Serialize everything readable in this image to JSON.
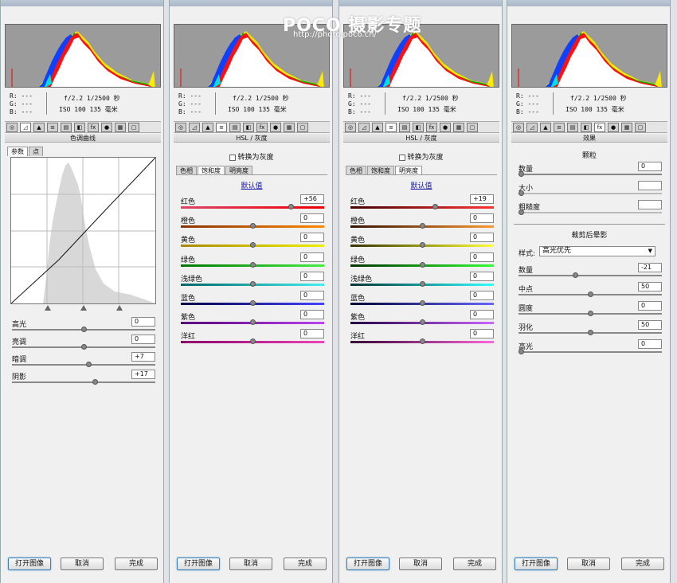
{
  "watermark": {
    "brand": "POCO",
    "cn": "摄影专题",
    "url": "http://photo.poco.cn/"
  },
  "info": {
    "r": "R:  ---",
    "g": "G:  ---",
    "b": "B:  ---",
    "line1": "f/2.2  1/2500 秒",
    "line2": "ISO 100  135 毫米"
  },
  "buttons": {
    "open": "打开图像",
    "cancel": "取消",
    "done": "完成"
  },
  "panel1": {
    "title": "色调曲线",
    "tabs": [
      "参数",
      "点"
    ],
    "rows": [
      {
        "label": "高光",
        "value": "0",
        "pos": 0.5
      },
      {
        "label": "亮调",
        "value": "0",
        "pos": 0.5
      },
      {
        "label": "暗调",
        "value": "+7",
        "pos": 0.535
      },
      {
        "label": "阴影",
        "value": "+17",
        "pos": 0.585
      }
    ]
  },
  "panel2": {
    "title": "HSL / 灰度",
    "checkbox": "转换为灰度",
    "tabs": [
      "色相",
      "饱和度",
      "明亮度"
    ],
    "link": "默认值",
    "rows": [
      {
        "label": "红色",
        "value": "+56",
        "pos": 0.78
      },
      {
        "label": "橙色",
        "value": "0",
        "pos": 0.5
      },
      {
        "label": "黄色",
        "value": "0",
        "pos": 0.5
      },
      {
        "label": "绿色",
        "value": "0",
        "pos": 0.5
      },
      {
        "label": "浅绿色",
        "value": "0",
        "pos": 0.5
      },
      {
        "label": "蓝色",
        "value": "0",
        "pos": 0.5
      },
      {
        "label": "紫色",
        "value": "0",
        "pos": 0.5
      },
      {
        "label": "洋红",
        "value": "0",
        "pos": 0.5
      }
    ]
  },
  "panel3": {
    "title": "HSL / 灰度",
    "checkbox": "转换为灰度",
    "tabs": [
      "色相",
      "饱和度",
      "明亮度"
    ],
    "link": "默认值",
    "rows": [
      {
        "label": "红色",
        "value": "+19",
        "pos": 0.595
      },
      {
        "label": "橙色",
        "value": "0",
        "pos": 0.5
      },
      {
        "label": "黄色",
        "value": "0",
        "pos": 0.5
      },
      {
        "label": "绿色",
        "value": "0",
        "pos": 0.5
      },
      {
        "label": "浅绿色",
        "value": "0",
        "pos": 0.5
      },
      {
        "label": "蓝色",
        "value": "0",
        "pos": 0.5
      },
      {
        "label": "紫色",
        "value": "0",
        "pos": 0.5
      },
      {
        "label": "洋红",
        "value": "0",
        "pos": 0.5
      }
    ]
  },
  "panel4": {
    "title": "效果",
    "grain_title": "颗粒",
    "grain_rows": [
      {
        "label": "数量",
        "value": "0",
        "pos": 0.0
      },
      {
        "label": "大小",
        "value": "",
        "pos": 0.0
      },
      {
        "label": "粗糙度",
        "value": "",
        "pos": 0.0
      }
    ],
    "vignette_title": "裁剪后晕影",
    "style_label": "样式:",
    "style_value": "高光优先",
    "vignette_rows": [
      {
        "label": "数量",
        "value": "-21",
        "pos": 0.395
      },
      {
        "label": "中点",
        "value": "50",
        "pos": 0.5
      },
      {
        "label": "圆度",
        "value": "0",
        "pos": 0.5
      },
      {
        "label": "羽化",
        "value": "50",
        "pos": 0.5
      },
      {
        "label": "高光",
        "value": "0",
        "pos": 0.0
      }
    ]
  }
}
